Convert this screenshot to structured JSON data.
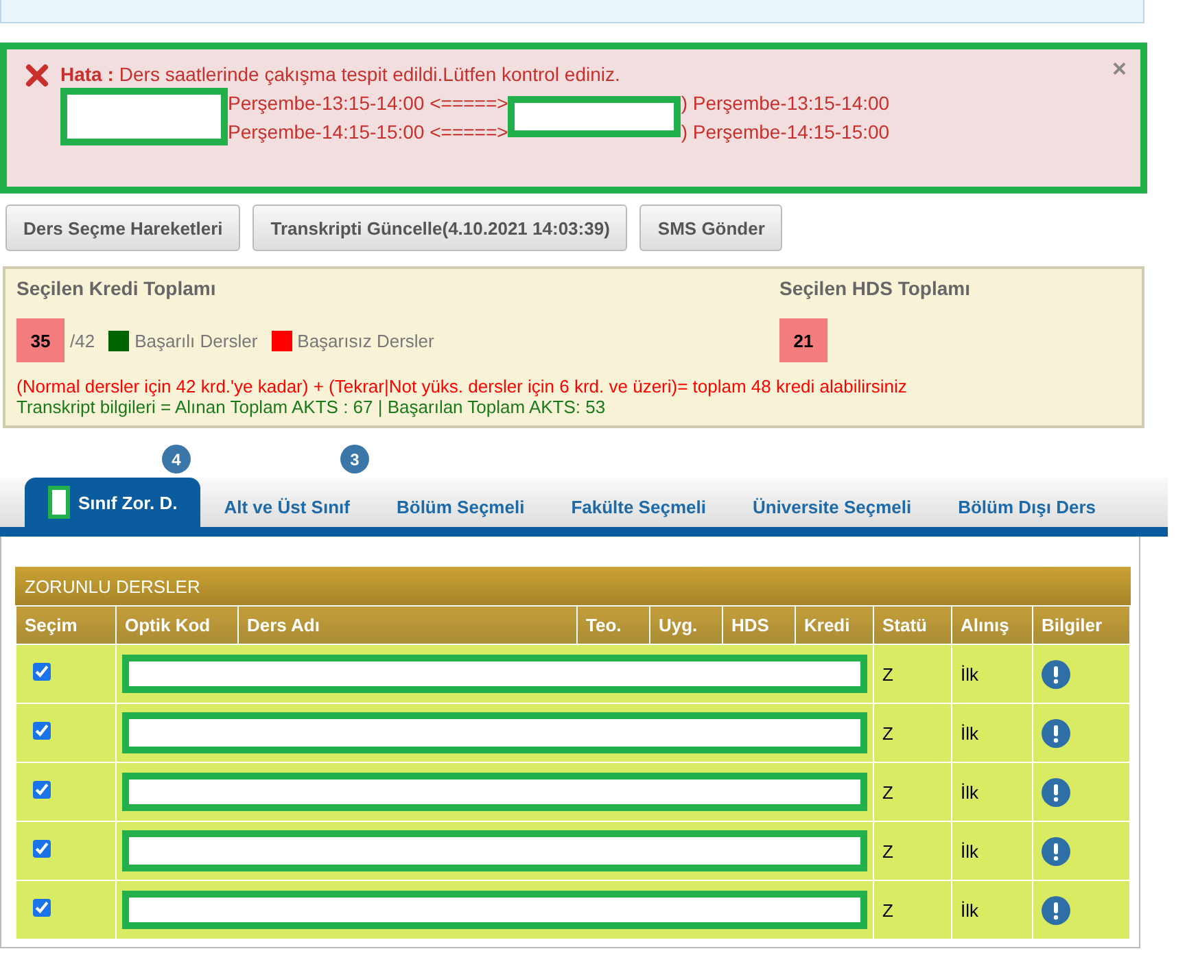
{
  "alert": {
    "label": "Hata :",
    "message": "Ders saatlerinde çakışma tespit edildi.Lütfen kontrol ediniz.",
    "close": "×",
    "conflicts": [
      {
        "left": "Perşembe-13:15-14:00 <=====>",
        "right": ") Perşembe-13:15-14:00"
      },
      {
        "left": "Perşembe-14:15-15:00 <=====>",
        "right": ") Perşembe-14:15-15:00"
      }
    ]
  },
  "buttons": [
    "Ders Seçme Hareketleri",
    "Transkripti Güncelle(4.10.2021 14:03:39)",
    "SMS Gönder"
  ],
  "summary": {
    "credit_title": "Seçilen Kredi Toplamı",
    "credit_value": "35",
    "credit_max": "/42",
    "legend": [
      {
        "label": "Başarılı Dersler",
        "color": "#006400"
      },
      {
        "label": "Başarısız Dersler",
        "color": "#ff0000"
      }
    ],
    "hds_title": "Seçilen HDS Toplamı",
    "hds_value": "21",
    "note": "(Normal dersler için 42 krd.'ye kadar) + (Tekrar|Not yüks. dersler için 6 krd. ve üzeri)= toplam 48 kredi alabilirsiniz",
    "transcript": "Transkript bilgileri = Alınan Toplam AKTS : 67 | Başarılan Toplam AKTS: 53"
  },
  "tabs": [
    {
      "label": "Sınıf Zor. D.",
      "selected": true,
      "badge": "4"
    },
    {
      "label": "Alt ve Üst Sınıf",
      "selected": false,
      "badge": "3"
    },
    {
      "label": "Bölüm Seçmeli",
      "selected": false
    },
    {
      "label": "Fakülte Seçmeli",
      "selected": false
    },
    {
      "label": "Üniversite Seçmeli",
      "selected": false
    },
    {
      "label": "Bölüm Dışı Ders",
      "selected": false
    }
  ],
  "table": {
    "title": "ZORUNLU DERSLER",
    "columns": [
      "Seçim",
      "Optik Kod",
      "Ders Adı",
      "Teo.",
      "Uyg.",
      "HDS",
      "Kredi",
      "Statü",
      "Alınış",
      "Bilgiler"
    ],
    "rows": [
      {
        "checked": true,
        "status": "Z",
        "taken": "İlk"
      },
      {
        "checked": true,
        "status": "Z",
        "taken": "İlk"
      },
      {
        "checked": true,
        "status": "Z",
        "taken": "İlk"
      },
      {
        "checked": true,
        "status": "Z",
        "taken": "İlk"
      },
      {
        "checked": true,
        "status": "Z",
        "taken": "İlk"
      }
    ]
  }
}
